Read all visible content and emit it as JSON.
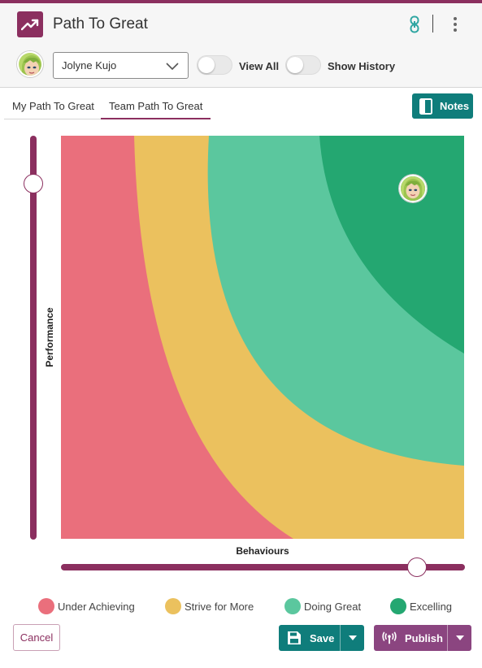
{
  "colors": {
    "brand": "#8b2f5f",
    "teal": "#0f7d7b",
    "publish": "#8b4580",
    "under_achieving": "#ea6f7c",
    "strive_for_more": "#ebc15e",
    "doing_great": "#5bc79e",
    "excelling": "#24a771"
  },
  "header": {
    "app_icon": "trend-up-icon",
    "title": "Path To Great",
    "link_icon": "link-icon",
    "menu_icon": "kebab-menu-icon"
  },
  "person_select": {
    "value": "Jolyne Kujo",
    "chevron_icon": "chevron-down-icon"
  },
  "toggles": {
    "view_all": {
      "label": "View All",
      "checked": false
    },
    "show_history": {
      "label": "Show History",
      "checked": false
    }
  },
  "tabs": {
    "my": "My Path To Great",
    "team": "Team Path To Great",
    "active": "team"
  },
  "notes_button": {
    "label": "Notes",
    "icon": "notes-icon"
  },
  "axes": {
    "y_label": "Performance",
    "x_label": "Behaviours"
  },
  "legend": [
    {
      "label": "Under Achieving",
      "color": "#ea6f7c"
    },
    {
      "label": "Strive for More",
      "color": "#ebc15e"
    },
    {
      "label": "Doing Great",
      "color": "#5bc79e"
    },
    {
      "label": "Excelling",
      "color": "#24a771"
    }
  ],
  "footer": {
    "cancel": "Cancel",
    "save": "Save",
    "save_icon": "save-icon",
    "publish": "Publish",
    "publish_icon": "broadcast-icon",
    "caret_icon": "caret-down-icon"
  }
}
